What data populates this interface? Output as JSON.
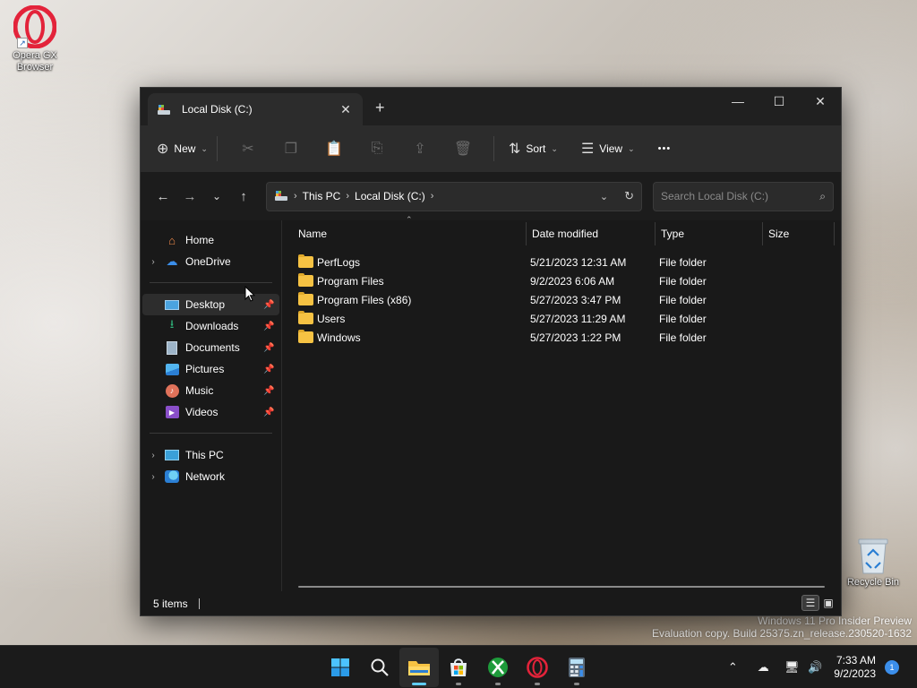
{
  "desktop": {
    "opera_icon_label": "Opera GX Browser",
    "recycle_bin_label": "Recycle Bin",
    "watermark_line1": "Windows 11 Pro Insider Preview",
    "watermark_line2": "Evaluation copy. Build 25375.zn_release.230520-1632"
  },
  "window": {
    "tab_title": "Local Disk (C:)",
    "new_tab": "+",
    "controls": {
      "minimize": "—",
      "maximize": "☐",
      "close": "✕"
    }
  },
  "toolbar": {
    "new_label": "New",
    "sort_label": "Sort",
    "view_label": "View",
    "more_label": "•••"
  },
  "address": {
    "crumbs": [
      "This PC",
      "Local Disk (C:)"
    ]
  },
  "search": {
    "placeholder": "Search Local Disk (C:)"
  },
  "sidebar": {
    "home": "Home",
    "onedrive": "OneDrive",
    "quick": [
      "Desktop",
      "Downloads",
      "Documents",
      "Pictures",
      "Music",
      "Videos"
    ],
    "this_pc": "This PC",
    "network": "Network"
  },
  "columns": {
    "name": "Name",
    "date": "Date modified",
    "type": "Type",
    "size": "Size"
  },
  "files": [
    {
      "name": "PerfLogs",
      "date": "5/21/2023 12:31 AM",
      "type": "File folder"
    },
    {
      "name": "Program Files",
      "date": "9/2/2023 6:06 AM",
      "type": "File folder"
    },
    {
      "name": "Program Files (x86)",
      "date": "5/27/2023 3:47 PM",
      "type": "File folder"
    },
    {
      "name": "Users",
      "date": "5/27/2023 11:29 AM",
      "type": "File folder"
    },
    {
      "name": "Windows",
      "date": "5/27/2023 1:22 PM",
      "type": "File folder"
    }
  ],
  "status": {
    "items": "5 items"
  },
  "taskbar": {
    "time": "7:33 AM",
    "date": "9/2/2023",
    "notification_count": "1"
  },
  "colors": {
    "accent": "#60cdff",
    "folder": "#f6c243",
    "window_bg": "#191919"
  }
}
